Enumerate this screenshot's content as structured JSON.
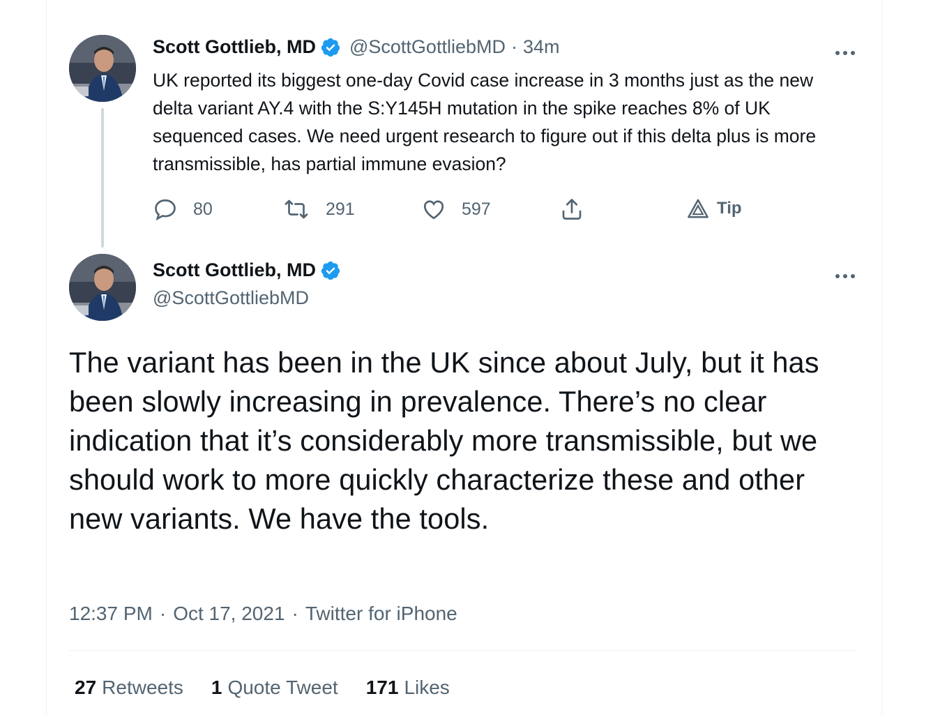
{
  "parent_tweet": {
    "author_name": "Scott Gottlieb, MD",
    "author_handle": "@ScottGottliebMD",
    "separator": "·",
    "time_ago": "34m",
    "text": "UK reported its biggest one-day Covid case increase in 3 months just as the new delta variant AY.4  with the S:Y145H mutation in the spike reaches 8% of UK sequenced cases. We need urgent research to figure out if this delta plus is more transmissible, has partial immune evasion?",
    "actions": {
      "reply_count": "80",
      "retweet_count": "291",
      "like_count": "597",
      "tip_label": "Tip"
    },
    "icons": [
      "avatar",
      "verified-badge-icon",
      "more-options-icon",
      "reply-icon",
      "retweet-icon",
      "like-icon",
      "share-icon",
      "tip-icon"
    ]
  },
  "main_tweet": {
    "author_name": "Scott Gottlieb, MD",
    "author_handle": "@ScottGottliebMD",
    "text": "The variant has been in the UK since about July, but it has been slowly increasing in prevalence. There’s no clear indication that it’s considerably more transmissible, but we should work to more quickly characterize these and other new variants. We have the tools.",
    "time": "12:37 PM",
    "date": "Oct 17, 2021",
    "source": "Twitter for iPhone",
    "meta_separator": "·",
    "stats": {
      "retweets_count": "27",
      "retweets_label": "Retweets",
      "quotes_count": "1",
      "quotes_label": "Quote Tweet",
      "likes_count": "171",
      "likes_label": "Likes"
    }
  },
  "colors": {
    "text_primary": "#0f1419",
    "text_secondary": "#536471",
    "verified_blue": "#1d9bf0",
    "thread_line": "#cfd9de",
    "divider": "#eff3f4"
  }
}
